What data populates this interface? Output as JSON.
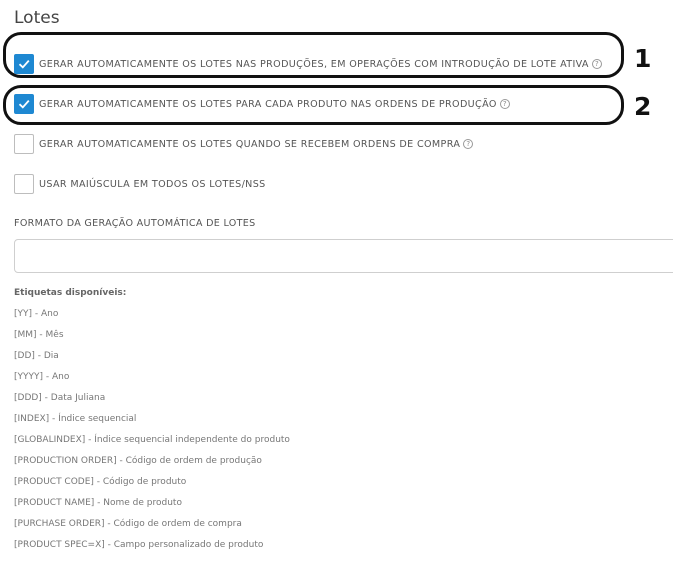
{
  "section": {
    "title": "Lotes"
  },
  "options": [
    {
      "label": "GERAR AUTOMATICAMENTE OS LOTES NAS PRODUÇÕES, EM OPERAÇÕES COM INTRODUÇÃO DE LOTE ATIVA",
      "checked": true,
      "help": true
    },
    {
      "label": "GERAR AUTOMATICAMENTE OS LOTES PARA CADA PRODUTO NAS ORDENS DE PRODUÇÃO",
      "checked": true,
      "help": true
    },
    {
      "label": "GERAR AUTOMATICAMENTE OS LOTES QUANDO SE RECEBEM ORDENS DE COMPRA",
      "checked": false,
      "help": true
    },
    {
      "label": "USAR MAIÚSCULA EM TODOS OS LOTES/NSS",
      "checked": false,
      "help": false
    }
  ],
  "annotations": {
    "marker_1": "1",
    "marker_2": "2"
  },
  "format_field": {
    "label": "FORMATO DA GERAÇÃO AUTOMÁTICA DE LOTES",
    "value": ""
  },
  "tags": {
    "title": "Etiquetas disponíveis:",
    "items": [
      "[YY] - Ano",
      "[MM] - Mês",
      "[DD] - Dia",
      "[YYYY] - Ano",
      "[DDD] - Data Juliana",
      "[INDEX] - Índice sequencial",
      "[GLOBALINDEX] - Índice sequencial independente do produto",
      "[PRODUCTION ORDER] - Código de ordem de produção",
      "[PRODUCT CODE] - Código de produto",
      "[PRODUCT NAME] - Nome de produto",
      "[PURCHASE ORDER] - Código de ordem de compra",
      "[PRODUCT SPEC=X] - Campo personalizado de produto"
    ]
  },
  "colors": {
    "accent": "#1e88d2",
    "annotation": "#111111"
  },
  "icons": {
    "checked": "checkmark-icon",
    "help": "question-circle-icon"
  }
}
